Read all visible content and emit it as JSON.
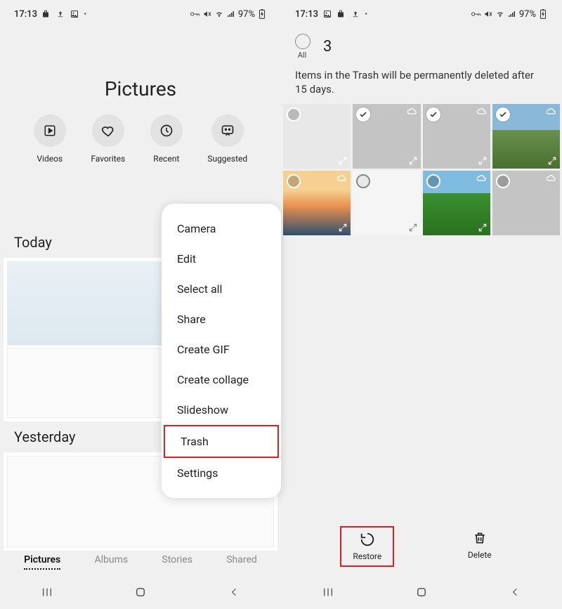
{
  "status": {
    "time": "17:13",
    "battery": "97%"
  },
  "left": {
    "title": "Pictures",
    "quick": [
      {
        "label": "Videos",
        "icon": "play"
      },
      {
        "label": "Favorites",
        "icon": "heart"
      },
      {
        "label": "Recent",
        "icon": "clock"
      },
      {
        "label": "Suggested",
        "icon": "chat"
      }
    ],
    "sections": {
      "today": "Today",
      "yesterday": "Yesterday"
    },
    "menu": [
      "Camera",
      "Edit",
      "Select all",
      "Share",
      "Create GIF",
      "Create collage",
      "Slideshow",
      "Trash",
      "Settings"
    ],
    "tabs": [
      "Pictures",
      "Albums",
      "Stories",
      "Shared"
    ]
  },
  "right": {
    "select_count": "3",
    "select_all_label": "All",
    "trash_message": "Items in the Trash will be permanently deleted after 15 days.",
    "actions": {
      "restore": "Restore",
      "delete": "Delete"
    }
  }
}
